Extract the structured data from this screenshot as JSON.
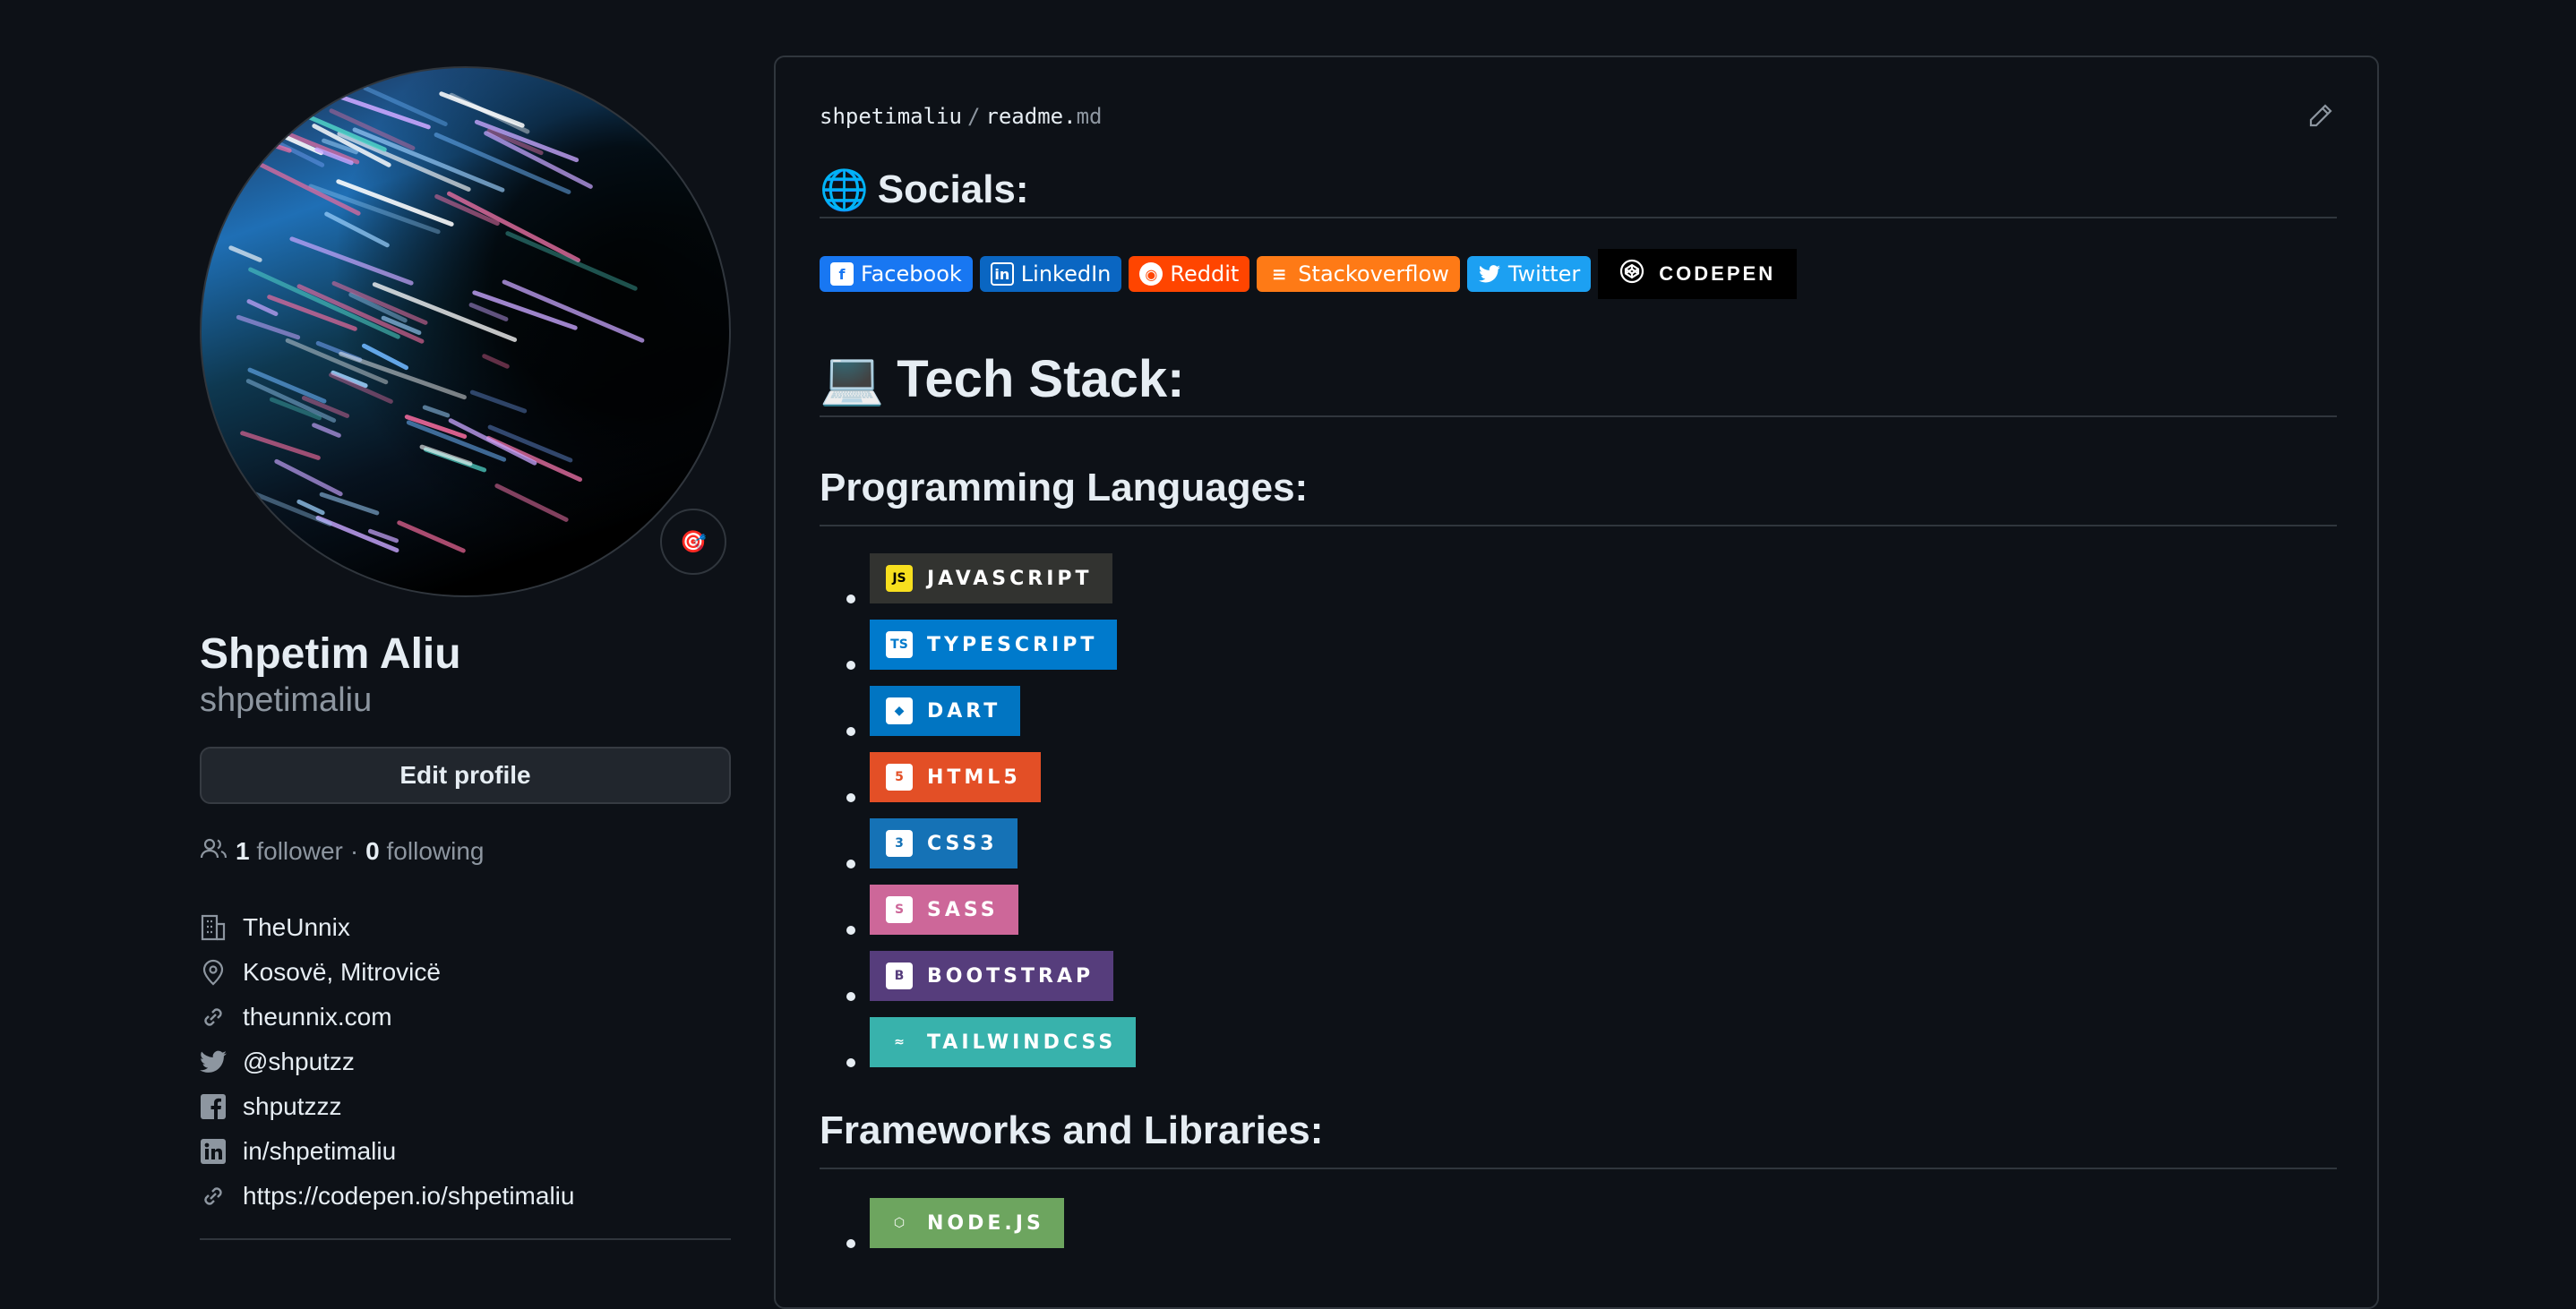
{
  "profile": {
    "full_name": "Shpetim Aliu",
    "username": "shpetimaliu",
    "edit_label": "Edit profile",
    "followers_count": "1",
    "followers_label": "follower",
    "following_count": "0",
    "following_label": "following",
    "separator": "·",
    "status_emoji": "🎯",
    "details": [
      {
        "icon": "organization-icon",
        "text": "TheUnnix"
      },
      {
        "icon": "location-icon",
        "text": "Kosovë, Mitrovicë"
      },
      {
        "icon": "link-icon",
        "text": "theunnix.com"
      },
      {
        "icon": "twitter-icon",
        "text": "@shputzz"
      },
      {
        "icon": "facebook-icon",
        "text": "shputzzz"
      },
      {
        "icon": "linkedin-icon",
        "text": "in/shpetimaliu"
      },
      {
        "icon": "link-icon",
        "text": "https://codepen.io/shpetimaliu"
      }
    ]
  },
  "readme": {
    "owner": "shpetimaliu",
    "slash": "/",
    "file": "readme.",
    "ext": "md",
    "socials_emoji": "🌐",
    "socials_heading": "Socials:",
    "socials": [
      {
        "label": "Facebook",
        "color": "#1877f2",
        "icon": "facebook-icon"
      },
      {
        "label": "LinkedIn",
        "color": "#0a66c2",
        "icon": "linkedin-icon"
      },
      {
        "label": "Reddit",
        "color": "#ff4500",
        "icon": "reddit-icon"
      },
      {
        "label": "Stackoverflow",
        "color": "#fe7a16",
        "icon": "stackoverflow-icon"
      },
      {
        "label": "Twitter",
        "color": "#1ca0f2",
        "icon": "twitter-icon"
      }
    ],
    "codepen_label": "CODEPEN",
    "tech_emoji": "💻",
    "tech_heading": "Tech Stack:",
    "languages_heading": "Programming Languages:",
    "languages": [
      {
        "label": "JAVASCRIPT",
        "color": "#323330",
        "logo_color": "#f7df1e",
        "logo_text": "JS",
        "logo_text_color": "#000"
      },
      {
        "label": "TYPESCRIPT",
        "color": "#007acc",
        "logo_color": "#ffffff",
        "logo_text": "TS",
        "logo_text_color": "#007acc"
      },
      {
        "label": "DART",
        "color": "#0175c2",
        "logo_color": "#ffffff",
        "logo_text": "◆",
        "logo_text_color": "#0175c2"
      },
      {
        "label": "HTML5",
        "color": "#e34f26",
        "logo_color": "#ffffff",
        "logo_text": "5",
        "logo_text_color": "#e34f26"
      },
      {
        "label": "CSS3",
        "color": "#1572b6",
        "logo_color": "#ffffff",
        "logo_text": "3",
        "logo_text_color": "#1572b6"
      },
      {
        "label": "SASS",
        "color": "#cd6799",
        "logo_color": "#ffffff",
        "logo_text": "S",
        "logo_text_color": "#cd6799"
      },
      {
        "label": "BOOTSTRAP",
        "color": "#563d7c",
        "logo_color": "#ffffff",
        "logo_text": "B",
        "logo_text_color": "#563d7c"
      },
      {
        "label": "TAILWINDCSS",
        "color": "#38b2ac",
        "logo_color": "transparent",
        "logo_text": "≈",
        "logo_text_color": "#ffffff"
      }
    ],
    "frameworks_heading": "Frameworks and Libraries:",
    "frameworks": [
      {
        "label": "NODE.JS",
        "color": "#6da55f",
        "logo_color": "transparent",
        "logo_text": "⬡",
        "logo_text_color": "#ffffff"
      }
    ]
  }
}
